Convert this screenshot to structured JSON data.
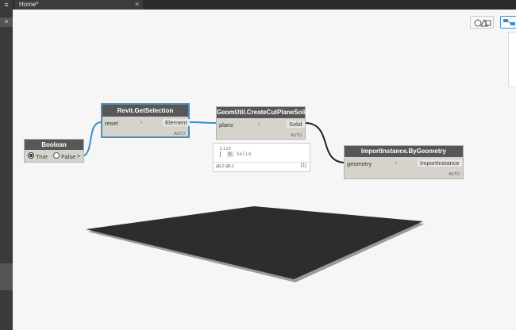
{
  "tabs": [
    {
      "label": "Home*",
      "close": "✕"
    }
  ],
  "menu_icon": "≡",
  "sidebar": {
    "close_label": "×"
  },
  "nodes": {
    "boolean": {
      "title": "Boolean",
      "true_label": "True",
      "false_label": "False",
      "output_arrow": ">"
    },
    "get_selection": {
      "title": "Revit.GetSelection",
      "input": "reset",
      "output": "Element",
      "lacing": "AUTO"
    },
    "cut_plane": {
      "title": "GeomUtil.CreateCutPlaneSolid",
      "input": "planv",
      "output": "Solid",
      "lacing": "AUTO"
    },
    "import_instance": {
      "title": "ImportInstance.ByGeometry",
      "input": "geometry",
      "output": "ImportInstance",
      "lacing": "AUTO"
    }
  },
  "preview": {
    "list_label": "List",
    "index": "0",
    "item": "Solid",
    "levels": "@L2 @L1",
    "count": "{1}"
  },
  "colors": {
    "node_header": "#575757",
    "node_body": "#d6d3cd",
    "selection": "#4a90c2",
    "wire_selected": "#3b8ec4",
    "wire": "#222222",
    "solid": "#2d2d2d"
  }
}
